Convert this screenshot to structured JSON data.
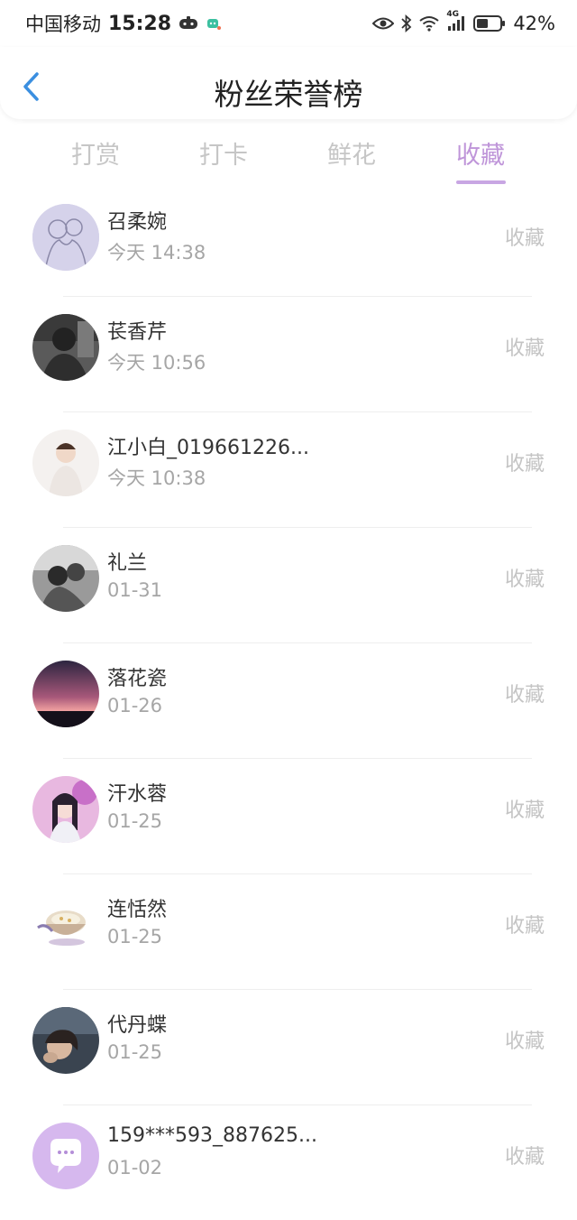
{
  "status_bar": {
    "carrier": "中国移动",
    "time": "15:28",
    "network": "4G",
    "battery": "42%"
  },
  "header": {
    "title": "粉丝荣誉榜",
    "back_icon": "chevron-left-icon"
  },
  "tabs": [
    {
      "label": "打赏",
      "active": false
    },
    {
      "label": "打卡",
      "active": false
    },
    {
      "label": "鲜花",
      "active": false
    },
    {
      "label": "收藏",
      "active": true
    }
  ],
  "colors": {
    "accent": "#bf95d9",
    "inactive_tab": "#c6c6c6",
    "secondary_text": "#a6a6a6",
    "back_icon": "#3b8fe0"
  },
  "items": [
    {
      "name": "召柔婉",
      "time": "今天 14:38",
      "action": "收藏"
    },
    {
      "name": "苌香芹",
      "time": "今天 10:56",
      "action": "收藏"
    },
    {
      "name": "江小白_019661226...",
      "time": "今天 10:38",
      "action": "收藏"
    },
    {
      "name": "礼兰",
      "time": "01-31",
      "action": "收藏"
    },
    {
      "name": "落花瓷",
      "time": "01-26",
      "action": "收藏"
    },
    {
      "name": "汗水蓉",
      "time": "01-25",
      "action": "收藏"
    },
    {
      "name": "连恬然",
      "time": "01-25",
      "action": "收藏"
    },
    {
      "name": "代丹蝶",
      "time": "01-25",
      "action": "收藏"
    },
    {
      "name": "159***593_887625...",
      "time": "01-02",
      "action": "收藏"
    }
  ]
}
